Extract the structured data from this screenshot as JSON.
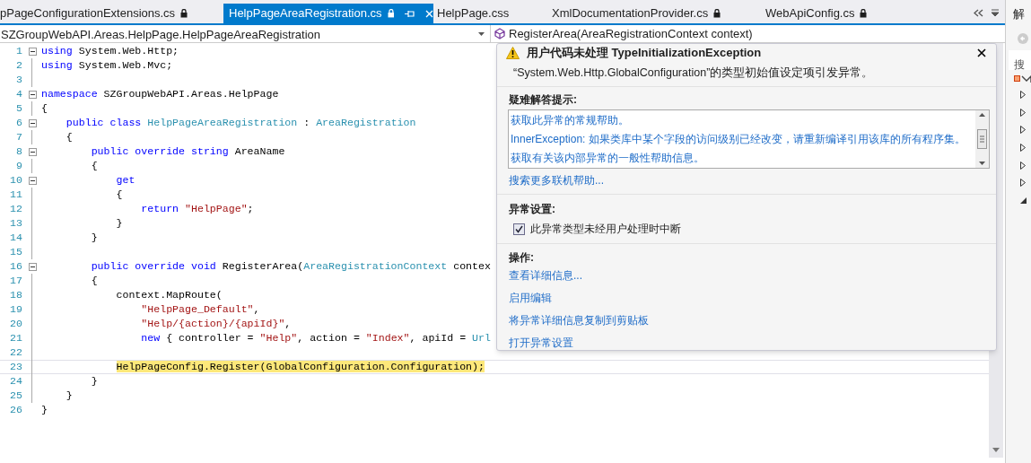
{
  "tabs": [
    {
      "label": "pPageConfigurationExtensions.cs",
      "read_only": true,
      "selected": false
    },
    {
      "label": "HelpPageAreaRegistration.cs",
      "read_only": true,
      "selected": true
    },
    {
      "label": "HelpPage.css",
      "read_only": false,
      "selected": false
    },
    {
      "label": "XmlDocumentationProvider.cs",
      "read_only": true,
      "selected": false
    },
    {
      "label": "WebApiConfig.cs",
      "read_only": true,
      "selected": false
    }
  ],
  "navigation": {
    "type_dropdown": "SZGroupWebAPI.Areas.HelpPage.HelpPageAreaRegistration",
    "member_dropdown": "RegisterArea(AreaRegistrationContext context)"
  },
  "code_lines": [
    {
      "number": "1",
      "collapsible": true,
      "tokens": [
        {
          "kind": "keyword",
          "text": "using"
        },
        {
          "kind": "plain",
          "text": " System.Web.Http;"
        }
      ]
    },
    {
      "number": "2",
      "collapsible": false,
      "tokens": [
        {
          "kind": "keyword",
          "text": "using"
        },
        {
          "kind": "plain",
          "text": " System.Web.Mvc;"
        }
      ]
    },
    {
      "number": "3",
      "collapsible": false
    },
    {
      "number": "4",
      "collapsible": true,
      "tokens": [
        {
          "kind": "keyword",
          "text": "namespace"
        },
        {
          "kind": "plain",
          "text": " SZGroupWebAPI.Areas.HelpPage"
        }
      ]
    },
    {
      "number": "5",
      "collapsible": false,
      "tokens": [
        {
          "kind": "plain",
          "text": "{"
        }
      ]
    },
    {
      "number": "6",
      "collapsible": true,
      "tokens": [
        {
          "kind": "keyword",
          "text": "    public class"
        },
        {
          "kind": "type",
          "text": " HelpPageAreaRegistration"
        },
        {
          "kind": "plain",
          "text": " : "
        },
        {
          "kind": "type",
          "text": "AreaRegistration"
        }
      ]
    },
    {
      "number": "7",
      "collapsible": false,
      "tokens": [
        {
          "kind": "plain",
          "text": "    {"
        }
      ]
    },
    {
      "number": "8",
      "collapsible": true,
      "tokens": [
        {
          "kind": "keyword",
          "text": "        public override string"
        },
        {
          "kind": "plain",
          "text": " AreaName"
        }
      ]
    },
    {
      "number": "9",
      "collapsible": false,
      "tokens": [
        {
          "kind": "plain",
          "text": "        {"
        }
      ]
    },
    {
      "number": "10",
      "collapsible": true,
      "tokens": [
        {
          "kind": "keyword",
          "text": "            get"
        }
      ]
    },
    {
      "number": "11",
      "collapsible": false,
      "tokens": [
        {
          "kind": "plain",
          "text": "            {"
        }
      ]
    },
    {
      "number": "12",
      "collapsible": false,
      "tokens": [
        {
          "kind": "keyword",
          "text": "                return"
        },
        {
          "kind": "string",
          "text": " \"HelpPage\""
        },
        {
          "kind": "plain",
          "text": ";"
        }
      ]
    },
    {
      "number": "13",
      "collapsible": false,
      "tokens": [
        {
          "kind": "plain",
          "text": "            }"
        }
      ]
    },
    {
      "number": "14",
      "collapsible": false,
      "tokens": [
        {
          "kind": "plain",
          "text": "        }"
        }
      ]
    },
    {
      "number": "15",
      "collapsible": false
    },
    {
      "number": "16",
      "collapsible": true,
      "tokens": [
        {
          "kind": "keyword",
          "text": "        public override void"
        },
        {
          "kind": "plain",
          "text": " RegisterArea("
        },
        {
          "kind": "type",
          "text": "AreaRegistrationContext"
        },
        {
          "kind": "plain",
          "text": " contex"
        }
      ]
    },
    {
      "number": "17",
      "collapsible": false,
      "tokens": [
        {
          "kind": "plain",
          "text": "        {"
        }
      ]
    },
    {
      "number": "18",
      "collapsible": false,
      "tokens": [
        {
          "kind": "plain",
          "text": "            context.MapRoute("
        }
      ]
    },
    {
      "number": "19",
      "collapsible": false,
      "tokens": [
        {
          "kind": "string",
          "text": "                \"HelpPage_Default\""
        },
        {
          "kind": "plain",
          "text": ","
        }
      ]
    },
    {
      "number": "20",
      "collapsible": false,
      "tokens": [
        {
          "kind": "string",
          "text": "                \"Help/{action}/{apiId}\""
        },
        {
          "kind": "plain",
          "text": ","
        }
      ]
    },
    {
      "number": "21",
      "collapsible": false,
      "tokens": [
        {
          "kind": "keyword",
          "text": "                new"
        },
        {
          "kind": "plain",
          "text": " { controller = "
        },
        {
          "kind": "string",
          "text": "\"Help\""
        },
        {
          "kind": "plain",
          "text": ", action = "
        },
        {
          "kind": "string",
          "text": "\"Index\""
        },
        {
          "kind": "plain",
          "text": ", apiId = "
        },
        {
          "kind": "type",
          "text": "Url"
        }
      ]
    },
    {
      "number": "22",
      "collapsible": false
    },
    {
      "number": "23",
      "collapsible": false,
      "tokens": [
        {
          "kind": "current",
          "text": "            HelpPageConfig.Register(GlobalConfiguration.Configuration);"
        }
      ]
    },
    {
      "number": "24",
      "collapsible": false,
      "tokens": [
        {
          "kind": "plain",
          "text": "        }"
        }
      ]
    },
    {
      "number": "25",
      "collapsible": false,
      "tokens": [
        {
          "kind": "plain",
          "text": "    }"
        }
      ]
    },
    {
      "number": "26",
      "collapsible": false,
      "tokens": [
        {
          "kind": "plain",
          "text": "}"
        }
      ]
    }
  ],
  "exception_popup": {
    "title": "用户代码未处理 TypeInitializationException",
    "message": "“System.Web.Http.GlobalConfiguration”的类型初始值设定项引发异常。",
    "troubleshooting_heading": "疑难解答提示:",
    "tips": [
      "获取此异常的常规帮助。",
      "InnerException: 如果类库中某个字段的访问级别已经改变，请重新编译引用该库的所有程序集。",
      "获取有关该内部异常的一般性帮助信息。"
    ],
    "search_link": "搜索更多联机帮助...",
    "settings_heading": "异常设置:",
    "break_option": {
      "label": "此异常类型未经用户处理时中断",
      "checked": true
    },
    "actions_heading": "操作:",
    "actions": [
      "查看详细信息...",
      "启用编辑",
      "将异常详细信息复制到剪贴板",
      "打开异常设置"
    ]
  },
  "solution_panel": {
    "title": "解",
    "search_placeholder": "搜",
    "tree": [
      {
        "expanded": false
      },
      {
        "expanded": false
      },
      {
        "expanded": false
      },
      {
        "expanded": false
      },
      {
        "expanded": false
      },
      {
        "expanded": false
      },
      {
        "expanded": true
      }
    ]
  }
}
